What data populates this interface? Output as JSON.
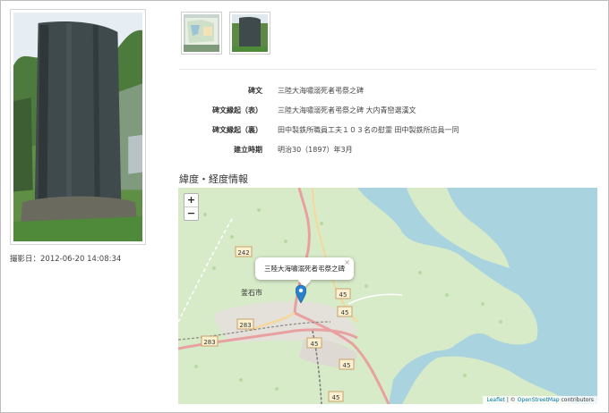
{
  "photo": {
    "caption_label": "撮影日：",
    "caption_date": "2012-06-20 14:08:34"
  },
  "thumbnails": [
    {
      "name": "map-sign-thumbnail"
    },
    {
      "name": "monument-thumbnail"
    }
  ],
  "info": [
    {
      "key": "碑文",
      "value": "三陸大海嘯溺死者弔祭之碑"
    },
    {
      "key": "碑文縁起（表）",
      "value": "三陸大海嘯溺死者弔祭之碑 大内青巒選漢文"
    },
    {
      "key": "碑文縁起（裏）",
      "value": "田中製鉄所職員工夫１０３名の慰霊 田中製鉄所店員一同"
    },
    {
      "key": "建立時期",
      "value": "明治30（1897）年3月"
    }
  ],
  "map_section": {
    "title": "緯度・経度情報",
    "popup_text": "三陸大海嘯溺死者弔祭之碑",
    "zoom_in": "+",
    "zoom_out": "−",
    "close": "×",
    "place_label": "釜石市",
    "route_numbers": [
      "242",
      "283",
      "283",
      "45",
      "45",
      "45",
      "45",
      "45"
    ],
    "attribution_leaflet": "Leaflet",
    "attribution_sep": " | © ",
    "attribution_osm": "OpenStreetMap",
    "attribution_suffix": " contributors",
    "colors": {
      "water": "#a9d3df",
      "land": "#d8ebc9",
      "road": "#e8a0a0",
      "marker": "#2a81cb"
    }
  }
}
